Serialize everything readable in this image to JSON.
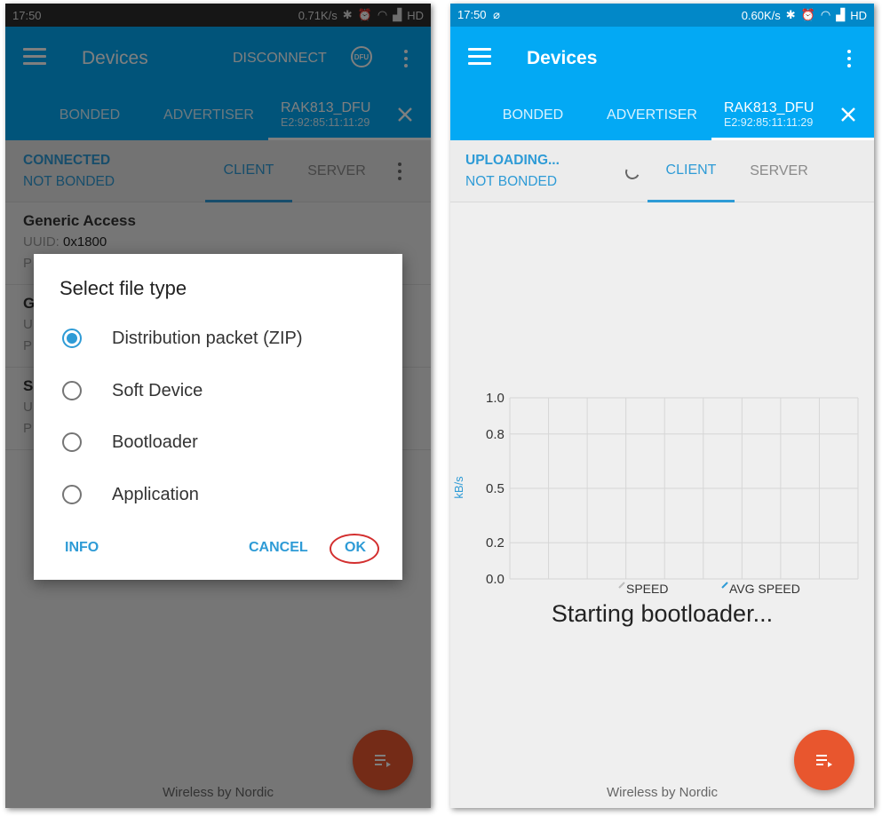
{
  "left": {
    "status": {
      "time": "17:50",
      "speed": "0.71K/s",
      "network": "HD"
    },
    "app": {
      "title": "Devices",
      "disconnect": "DISCONNECT",
      "dfu_badge": "DFU"
    },
    "device_tabs": {
      "bonded": "BONDED",
      "advertiser": "ADVERTISER",
      "device_name": "RAK813_DFU",
      "device_mac": "E2:92:85:11:11:29"
    },
    "connection": {
      "state": "CONNECTED",
      "bond": "NOT BONDED",
      "tab_client": "CLIENT",
      "tab_server": "SERVER"
    },
    "services": [
      {
        "name": "Generic Access",
        "uuid_label": "UUID:",
        "uuid": "0x1800",
        "row3": "P"
      },
      {
        "name": "G",
        "uuid_label": "U",
        "uuid": "",
        "row3": "P"
      },
      {
        "name": "S",
        "uuid_label": "U",
        "uuid": "",
        "row3": "P"
      }
    ],
    "dialog": {
      "title": "Select file type",
      "options": [
        {
          "label": "Distribution packet (ZIP)",
          "selected": true
        },
        {
          "label": "Soft Device",
          "selected": false
        },
        {
          "label": "Bootloader",
          "selected": false
        },
        {
          "label": "Application",
          "selected": false
        }
      ],
      "info": "INFO",
      "cancel": "CANCEL",
      "ok": "OK"
    },
    "footer": "Wireless by Nordic"
  },
  "right": {
    "status": {
      "time": "17:50",
      "speed": "0.60K/s",
      "network": "HD"
    },
    "app": {
      "title": "Devices"
    },
    "device_tabs": {
      "bonded": "BONDED",
      "advertiser": "ADVERTISER",
      "device_name": "RAK813_DFU",
      "device_mac": "E2:92:85:11:11:29"
    },
    "connection": {
      "state": "UPLOADING...",
      "bond": "NOT BONDED",
      "tab_client": "CLIENT",
      "tab_server": "SERVER"
    },
    "status_message": "Starting bootloader...",
    "footer": "Wireless by Nordic"
  },
  "colors": {
    "accent": "#2e9bd6",
    "appbar_right": "#03a9f4",
    "appbar_left_dimmed": "#1f5470",
    "fab": "#e8562e",
    "ok_ring": "#d32f2f"
  },
  "chart_data": {
    "type": "line",
    "ylabel": "kB/s",
    "yticks": [
      "1.0",
      "0.8",
      "0.5",
      "0.2",
      "0.0"
    ],
    "ylim": [
      0,
      1.0
    ],
    "grid": true,
    "series": [
      {
        "name": "SPEED",
        "values": []
      },
      {
        "name": "AVG SPEED",
        "values": []
      }
    ],
    "legend_position": "bottom"
  }
}
